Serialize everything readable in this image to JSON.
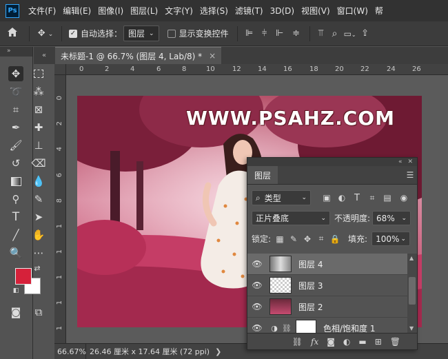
{
  "app": {
    "logo": "Ps"
  },
  "menu": [
    "文件(F)",
    "编辑(E)",
    "图像(I)",
    "图层(L)",
    "文字(Y)",
    "选择(S)",
    "滤镜(T)",
    "3D(D)",
    "视图(V)",
    "窗口(W)",
    "帮"
  ],
  "options": {
    "auto_select_label": "自动选择：",
    "auto_select_target": "图层",
    "show_transform_label": "显示变换控件"
  },
  "document": {
    "tab_title": "未标题-1 @ 66.7% (图层 4, Lab/8) *",
    "close": "×",
    "collapse": "«",
    "watermark": "WWW.PSAHZ.COM"
  },
  "ruler": {
    "h": [
      "0",
      "2",
      "4",
      "6",
      "8",
      "10",
      "12",
      "14",
      "16",
      "18",
      "20",
      "22",
      "24",
      "26"
    ],
    "v": [
      "0",
      "2",
      "4",
      "6",
      "8",
      "1",
      "1",
      "1",
      "1",
      "1",
      "1"
    ]
  },
  "status": {
    "zoom": "66.67%",
    "info": "26.46 厘米 x 17.64 厘米 (72 ppi)",
    "arrow": "❯"
  },
  "layers_panel": {
    "title": "图层",
    "filter": "类型",
    "blend_mode": "正片叠底",
    "opacity_label": "不透明度:",
    "opacity": "68%",
    "lock_label": "锁定:",
    "fill_label": "填充:",
    "fill": "100%",
    "layers": [
      {
        "name": "图层 4",
        "selected": true
      },
      {
        "name": "图层 3",
        "selected": false
      },
      {
        "name": "图层 2",
        "selected": false
      },
      {
        "name": "色相/饱和度 1",
        "selected": false
      }
    ]
  },
  "colors": {
    "foreground": "#d6213a",
    "background": "#ffffff"
  }
}
